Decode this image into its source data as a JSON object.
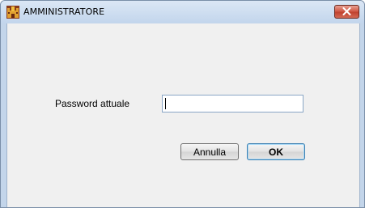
{
  "window": {
    "title": "AMMINISTRATORE",
    "icon": "castle-icon",
    "close_icon": "close-icon"
  },
  "form": {
    "password_label": "Password attuale",
    "password_value": "",
    "cancel_label": "Annulla",
    "ok_label": "OK"
  },
  "colors": {
    "titlebar": "#c3d5ea",
    "client_bg": "#f0f0f0",
    "close_button": "#c7503c",
    "input_border": "#8aa6c6",
    "ok_focus_border": "#3c7fb1"
  }
}
